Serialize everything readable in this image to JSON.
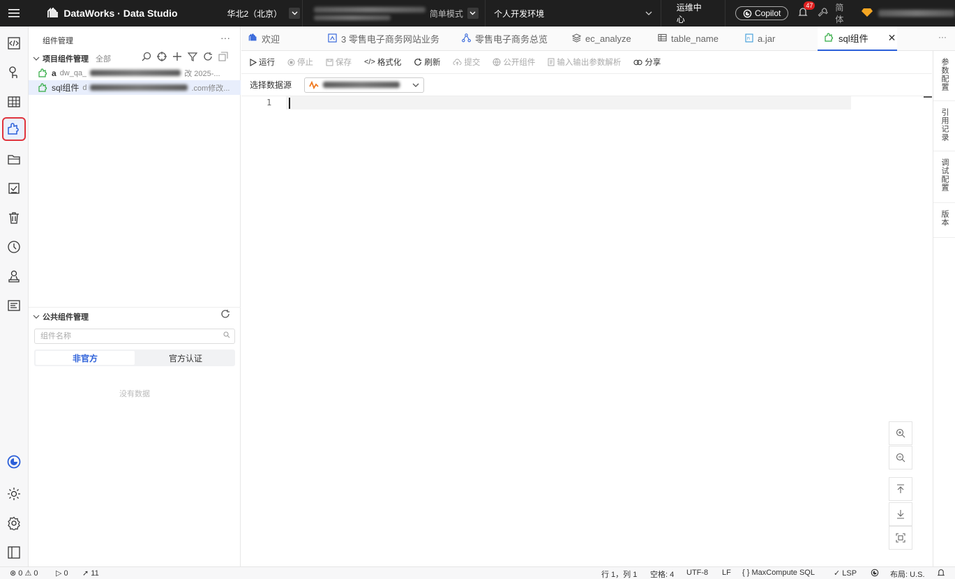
{
  "topbar": {
    "app_title": "DataWorks · Data Studio",
    "region": "华北2（北京）",
    "mode": "简单模式",
    "env": "个人开发环境",
    "ops_center": "运维中心",
    "copilot": "Copilot",
    "notifications": "47",
    "lang": "简体"
  },
  "sidepanel": {
    "title": "组件管理",
    "project_section": "项目组件管理",
    "filter_all": "全部",
    "items": [
      {
        "name": "a",
        "meta_prefix": "dw_qa_",
        "meta_suffix": "改 2025-..."
      },
      {
        "name": "sql组件",
        "meta_prefix": "d",
        "meta_suffix": ".com修改..."
      }
    ],
    "public_section": "公共组件管理",
    "search_placeholder": "组件名称",
    "tabs": [
      "非官方",
      "官方认证"
    ],
    "empty": "没有数据"
  },
  "tabs": [
    {
      "label": "欢迎",
      "icon": "dataworks-icon"
    },
    {
      "label": "3 零售电子商务网站业务",
      "icon": "workflow-icon"
    },
    {
      "label": "零售电子商务总览",
      "icon": "flow-icon"
    },
    {
      "label": "ec_analyze",
      "icon": "layers-icon"
    },
    {
      "label": "table_name",
      "icon": "table-icon"
    },
    {
      "label": "a.jar",
      "icon": "file-icon"
    },
    {
      "label": "sql组件",
      "icon": "component-icon"
    }
  ],
  "toolbar": {
    "run": "运行",
    "stop": "停止",
    "save": "保存",
    "format": "格式化",
    "refresh": "刷新",
    "submit": "提交",
    "publish": "公开组件",
    "parse": "输入输出参数解析",
    "share": "分享"
  },
  "datasource": {
    "label": "选择数据源"
  },
  "editor": {
    "line_number": "1"
  },
  "rightbar": {
    "items": [
      "参数配置",
      "引用记录",
      "调试配置",
      "版本"
    ]
  },
  "statusbar": {
    "errors": "0",
    "warnings": "0",
    "runs": "0",
    "sends": "11",
    "position": "行 1，列 1",
    "spaces": "空格: 4",
    "encoding": "UTF-8",
    "eol": "LF",
    "language": "MaxCompute SQL",
    "lsp": "LSP",
    "layout": "布局: U.S."
  }
}
